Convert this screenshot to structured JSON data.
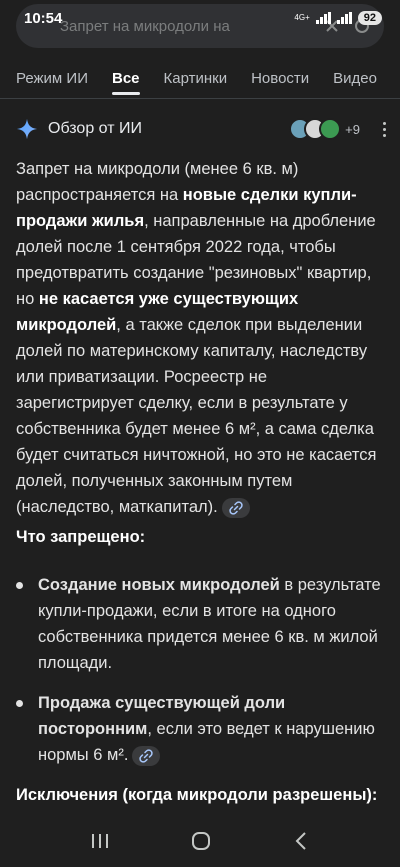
{
  "status": {
    "time": "10:54",
    "network": "4G+",
    "battery": "92"
  },
  "search": {
    "query": "Запрет на микродоли на"
  },
  "tabs": [
    "Режим ИИ",
    "Все",
    "Картинки",
    "Новости",
    "Видео"
  ],
  "ai_overview": {
    "title": "Обзор от ИИ",
    "sources_more": "+9",
    "paragraph": {
      "t1": "Запрет на микродоли (менее 6 кв. м) распространяется на ",
      "b1": "новые сделки купли-продажи жилья",
      "t2": ", направленные на дробление долей после 1 сентября 2022 года, чтобы предотвратить создание \"резиновых\" квартир, но ",
      "b2": "не касается уже существующих микродолей",
      "t3": ", а также сделок при выделении долей по материнскому капиталу, наследству или приватизации. Росреестр не зарегистрирует сделку, если в результате у собственника будет менее 6 м², а сама сделка будет считаться ничтожной, но это не касается долей, полученных законным путем (наследство, маткапитал)."
    },
    "section1_title": "Что запрещено:",
    "list": [
      {
        "bold": "Создание новых микродолей",
        "text": " в результате купли-продажи, если в итоге на одного собственника придется менее 6 кв. м жилой площади."
      },
      {
        "bold": "Продажа существующей доли посторонним",
        "text": ", если это ведет к нарушению нормы 6 м²."
      }
    ],
    "section2_title": "Исключения (когда микродоли разрешены):"
  }
}
